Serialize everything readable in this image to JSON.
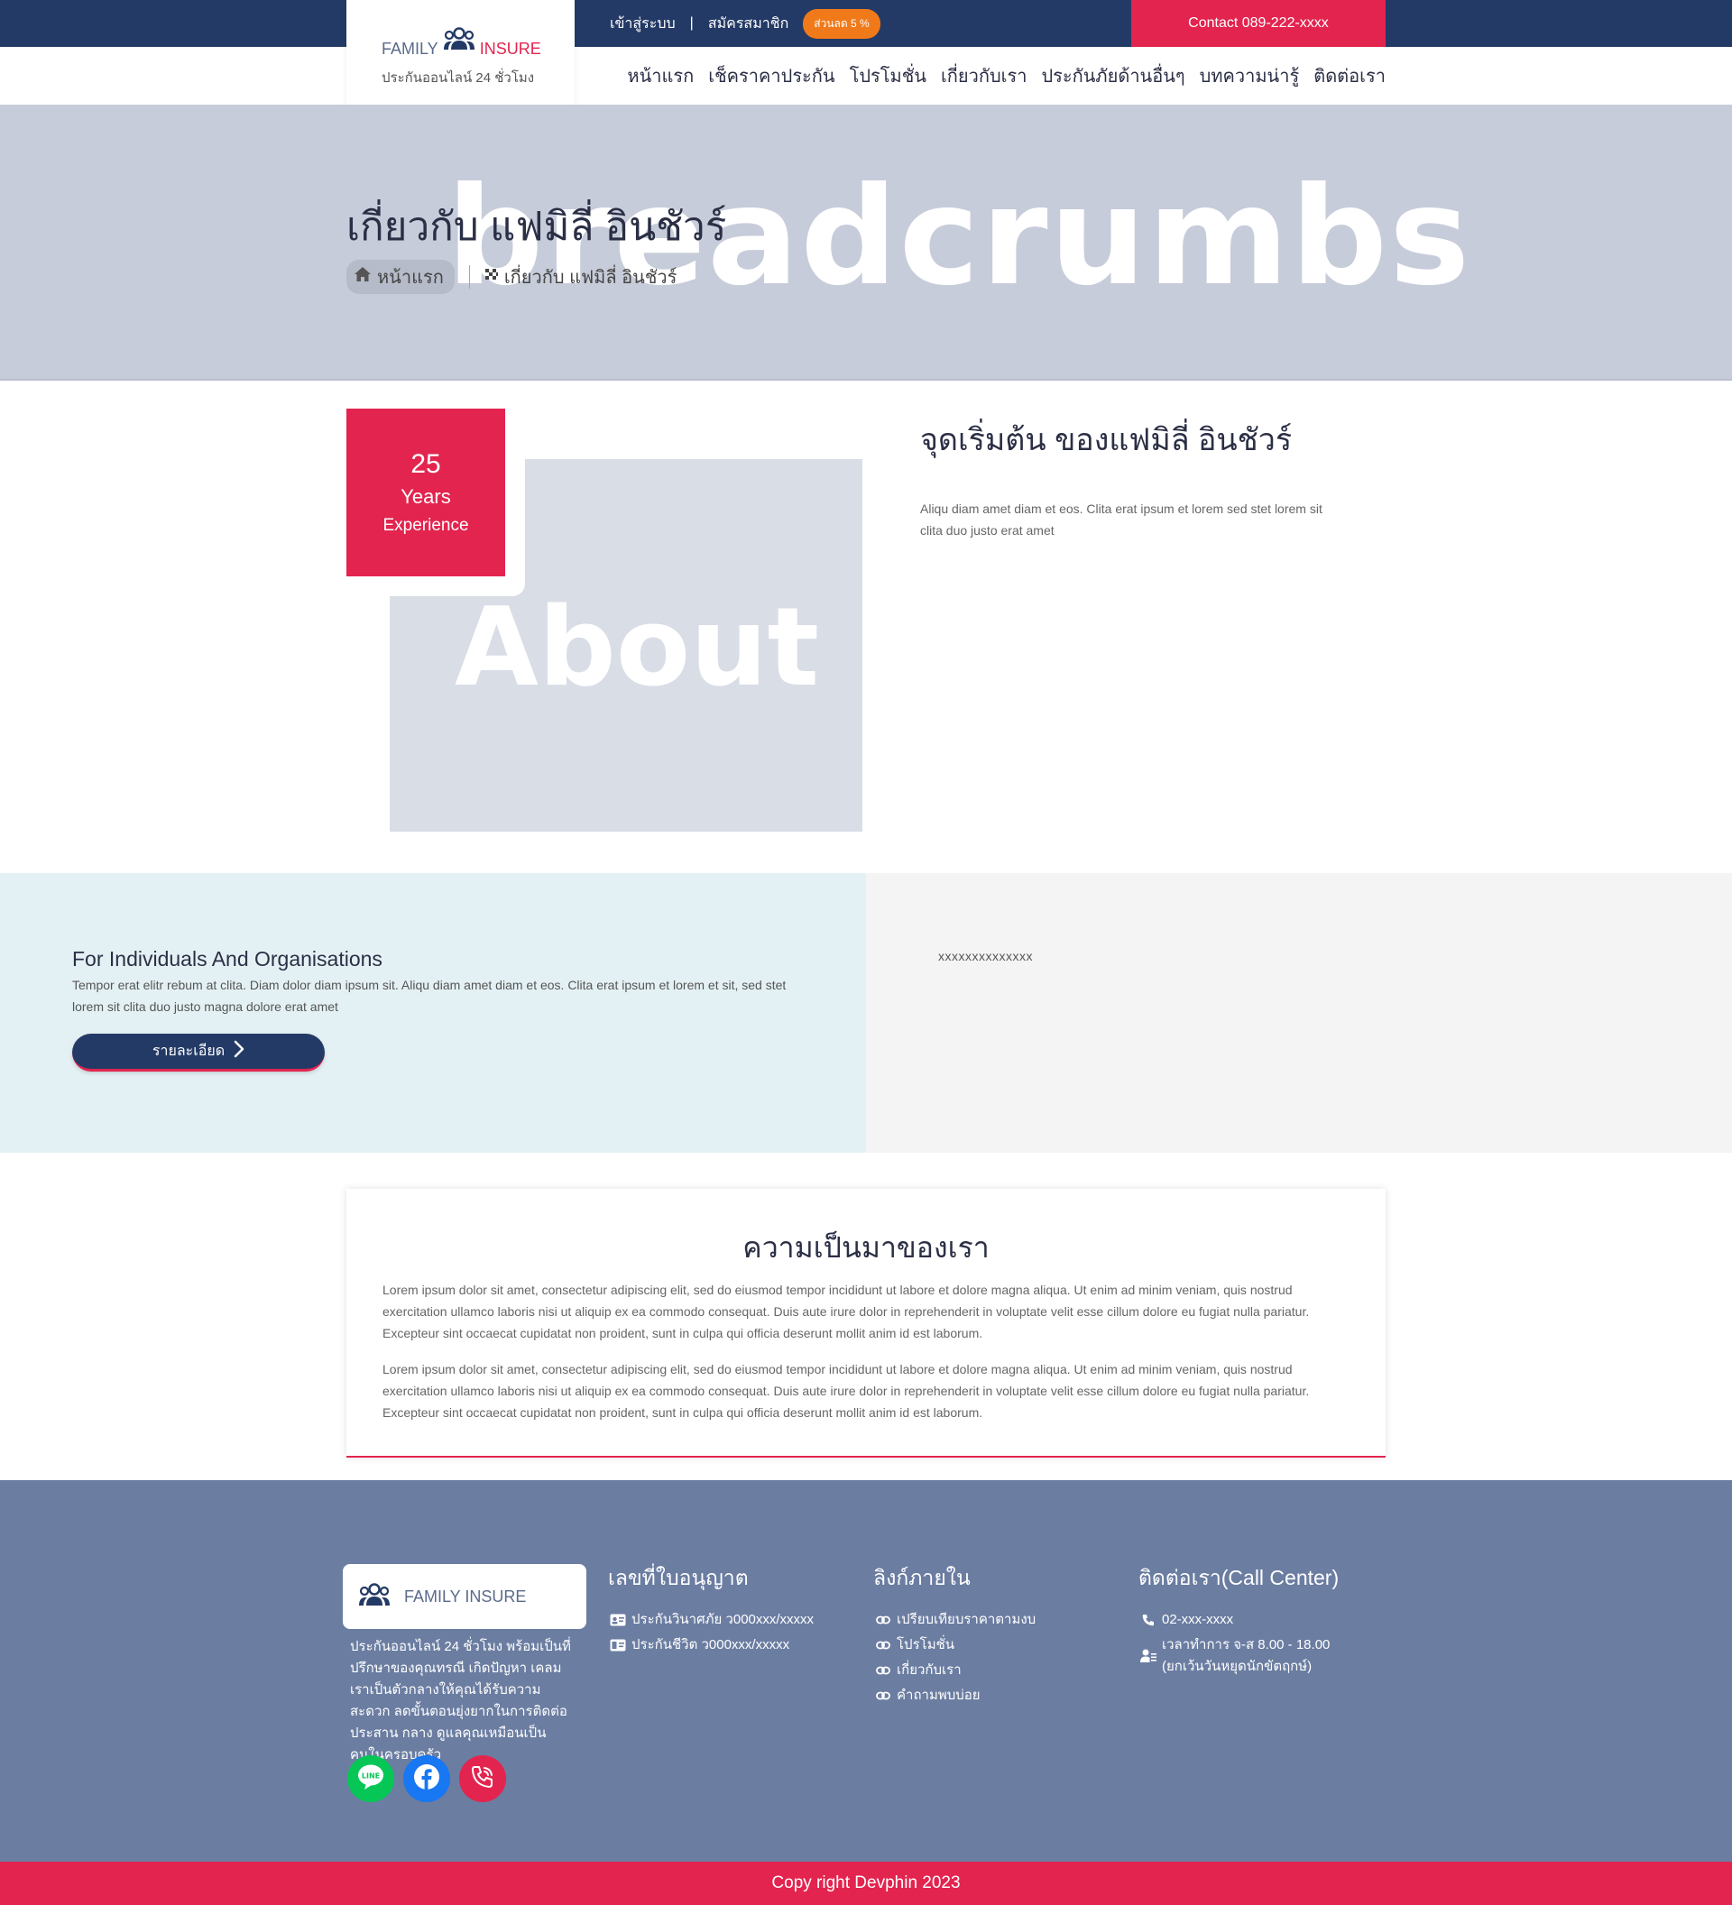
{
  "topbar": {
    "login": "เข้าสู่ระบบ",
    "separator": "|",
    "register": "สมัครสมาชิก",
    "discount": "ส่วนลด 5 %",
    "contact": "Contact 089-222-xxxx"
  },
  "logo": {
    "family": "FAMILY",
    "insure": "INSURE",
    "tagline": "ประกันออนไลน์ 24 ชั่วโมง",
    "icon": "family-icon"
  },
  "nav": {
    "items": [
      {
        "label": "หน้าแรก"
      },
      {
        "label": "เช็คราคาประกัน"
      },
      {
        "label": "โปรโมชั่น"
      },
      {
        "label": "เกี่ยวกับเรา"
      },
      {
        "label": "ประกันภัยด้านอื่นๆ"
      },
      {
        "label": "บทความน่ารู้"
      },
      {
        "label": "ติดต่อเรา"
      }
    ]
  },
  "hero": {
    "watermark": "breadcrumbs",
    "title": "เกี่ยวกับ แฟมิลี่ อินชัวร์",
    "breadcrumb_home": "หน้าแรก",
    "breadcrumb_current": "เกี่ยวกับ แฟมิลี่ อินชัวร์"
  },
  "about": {
    "years": "25",
    "years_label": "Years",
    "years_sub": "Experience",
    "watermark": "About",
    "heading": "จุดเริ่มต้น ของแฟมิลี่ อินชัวร์",
    "text": "Aliqu diam amet diam et eos. Clita erat ipsum et lorem sed stet lorem sit clita duo justo erat amet"
  },
  "split": {
    "title": "For Individuals And Organisations",
    "text": "Tempor erat elitr rebum at clita. Diam dolor diam ipsum sit. Aliqu diam amet diam et eos. Clita erat ipsum et lorem et sit, sed stet lorem sit clita duo justo magna dolore erat amet",
    "button": "รายละเอียด",
    "right_text": "xxxxxxxxxxxxxx"
  },
  "history": {
    "title": "ความเป็นมาของเรา",
    "paragraph1": "Lorem ipsum dolor sit amet, consectetur adipiscing elit, sed do eiusmod tempor incididunt ut labore et dolore magna aliqua. Ut enim ad minim veniam, quis nostrud exercitation ullamco laboris nisi ut aliquip ex ea commodo consequat. Duis aute irure dolor in reprehenderit in voluptate velit esse cillum dolore eu fugiat nulla pariatur. Excepteur sint occaecat cupidatat non proident, sunt in culpa qui officia deserunt mollit anim id est laborum.",
    "paragraph2": "Lorem ipsum dolor sit amet, consectetur adipiscing elit, sed do eiusmod tempor incididunt ut labore et dolore magna aliqua. Ut enim ad minim veniam, quis nostrud exercitation ullamco laboris nisi ut aliquip ex ea commodo consequat. Duis aute irure dolor in reprehenderit in voluptate velit esse cillum dolore eu fugiat nulla pariatur. Excepteur sint occaecat cupidatat non proident, sunt in culpa qui officia deserunt mollit anim id est laborum."
  },
  "footer": {
    "brand": "FAMILY INSURE",
    "about": "ประกันออนไลน์ 24 ชั่วโมง พร้อมเป็นที่ปรึกษาของคุณทรณี เกิดปัญหา เคลม เราเป็นตัวกลางให้คุณได้รับความสะดวก ลดขั้นตอนยุ่งยากในการติดต่อประสาน กลาง ดูแลคุณเหมือนเป็นคนในครอบครัว",
    "license_title": "เลขที่ใบอนุญาต",
    "license_items": [
      {
        "label": "ประกันวินาศภัย ว000xxx/xxxxx"
      },
      {
        "label": "ประกันชีวิต ว000xxx/xxxxx"
      }
    ],
    "links_title": "ลิงก์ภายใน",
    "links": [
      {
        "label": "เปรียบเทียบราคาตามงบ"
      },
      {
        "label": "โปรโมชั่น"
      },
      {
        "label": "เกี่ยวกับเรา"
      },
      {
        "label": "คำถามพบบ่อย"
      }
    ],
    "contact_title": "ติดต่อเรา(Call Center)",
    "phone": "02-xxx-xxxx",
    "hours": "เวลาทำการ จ-ส 8.00 - 18.00",
    "hours_note": "(ยกเว้นวันหยุดนักขัตฤกษ์)",
    "copyright": "Copy right Devphin 2023"
  },
  "colors": {
    "navy": "#243a66",
    "pink": "#e3244f",
    "orange": "#f07a1a",
    "hero_bg": "#c7ccda",
    "footer_bg": "#6b7da1"
  }
}
